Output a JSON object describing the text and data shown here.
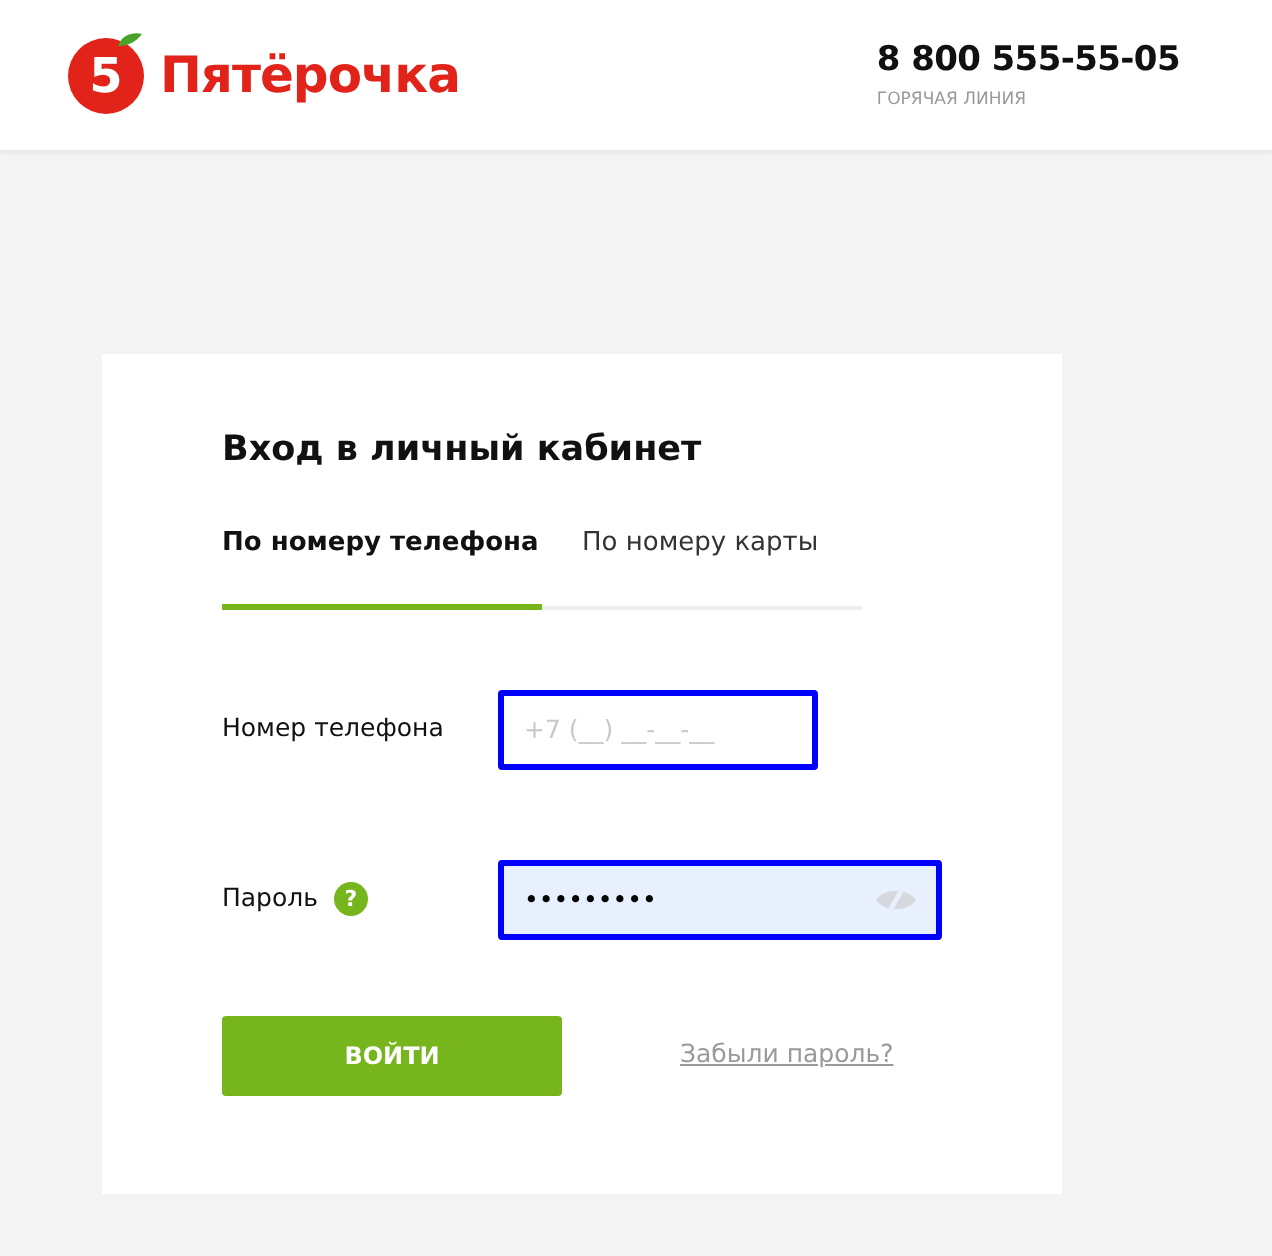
{
  "header": {
    "logo_mark": "5",
    "brand": "Пятёрочка",
    "phone": "8 800 555-55-05",
    "phone_caption": "ГОРЯЧАЯ ЛИНИЯ"
  },
  "login": {
    "title": "Вход в личный кабинет",
    "tabs": [
      {
        "label": "По номеру телефона",
        "selected": true
      },
      {
        "label": "По номеру карты",
        "selected": false
      }
    ],
    "phone": {
      "label": "Номер телефона",
      "placeholder": "+7 (__) __-__-__",
      "highlighted": true
    },
    "password": {
      "label": "Пароль",
      "help": "?",
      "value": "•••••••••",
      "highlighted": true,
      "autofilled": true
    },
    "submit": "ВОЙТИ",
    "forgot_link": "Забыли пароль?"
  }
}
